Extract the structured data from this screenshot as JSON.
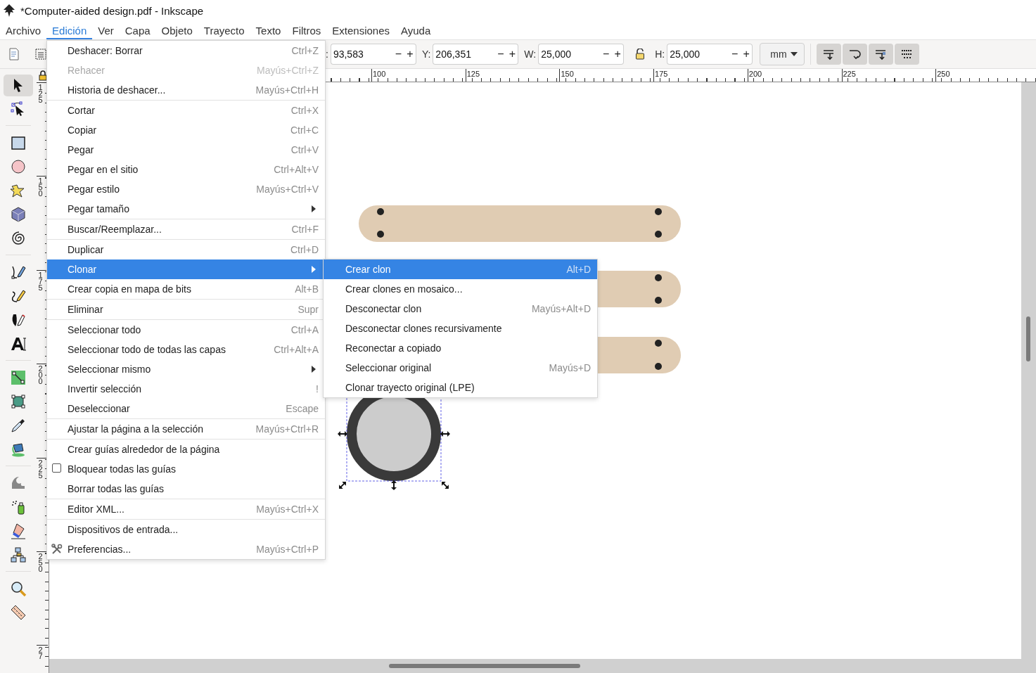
{
  "window": {
    "title": "*Computer-aided design.pdf - Inkscape"
  },
  "menubar": [
    {
      "label": "Archivo",
      "selected": false
    },
    {
      "label": "Edición",
      "selected": true
    },
    {
      "label": "Ver",
      "selected": false
    },
    {
      "label": "Capa",
      "selected": false
    },
    {
      "label": "Objeto",
      "selected": false
    },
    {
      "label": "Trayecto",
      "selected": false
    },
    {
      "label": "Texto",
      "selected": false
    },
    {
      "label": "Filtros",
      "selected": false
    },
    {
      "label": "Extensiones",
      "selected": false
    },
    {
      "label": "Ayuda",
      "selected": false
    }
  ],
  "toolbar": {
    "fields": [
      {
        "label": ":",
        "value": "93,583",
        "minus": "−",
        "plus": "+"
      },
      {
        "label": "Y:",
        "value": "206,351",
        "minus": "−",
        "plus": "+"
      },
      {
        "label": "W:",
        "value": "25,000",
        "minus": "−",
        "plus": "+"
      },
      {
        "label": "H:",
        "value": "25,000",
        "minus": "−",
        "plus": "+"
      }
    ],
    "unit": "mm"
  },
  "tools": [
    {
      "selected": true
    },
    {
      "selected": false
    },
    {
      "selected": false
    },
    {
      "selected": false
    },
    {
      "selected": false
    },
    {
      "selected": false
    },
    {
      "selected": false
    },
    {
      "selected": false
    },
    {
      "selected": false
    },
    {
      "selected": false
    },
    {
      "selected": false
    },
    {
      "selected": false
    },
    {
      "selected": false
    },
    {
      "selected": false
    },
    {
      "selected": false
    },
    {
      "selected": false
    },
    {
      "selected": false
    },
    {
      "selected": false
    },
    {
      "selected": false
    },
    {
      "selected": false
    },
    {
      "selected": false
    }
  ],
  "horizontal_ruler": {
    "labels": [
      "100",
      "125",
      "150",
      "175",
      "200",
      "225",
      "250"
    ]
  },
  "vertical_ruler": {
    "labels": [
      "125",
      "150",
      "175",
      "200",
      "225",
      "250",
      "27"
    ]
  },
  "edit_menu": {
    "items": [
      {
        "kind": "command",
        "label": "Deshacer: Borrar",
        "shortcut": "Ctrl+Z",
        "disabled": false,
        "selected": false
      },
      {
        "kind": "command",
        "label": "Rehacer",
        "shortcut": "Mayús+Ctrl+Z",
        "disabled": true,
        "selected": false
      },
      {
        "kind": "command",
        "label": "Historia de deshacer...",
        "shortcut": "Mayús+Ctrl+H",
        "disabled": false,
        "selected": false
      },
      {
        "kind": "separator"
      },
      {
        "kind": "command",
        "label": "Cortar",
        "shortcut": "Ctrl+X",
        "disabled": false,
        "selected": false
      },
      {
        "kind": "command",
        "label": "Copiar",
        "shortcut": "Ctrl+C",
        "disabled": false,
        "selected": false
      },
      {
        "kind": "command",
        "label": "Pegar",
        "shortcut": "Ctrl+V",
        "disabled": false,
        "selected": false
      },
      {
        "kind": "command",
        "label": "Pegar en el sitio",
        "shortcut": "Ctrl+Alt+V",
        "disabled": false,
        "selected": false
      },
      {
        "kind": "command",
        "label": "Pegar estilo",
        "shortcut": "Mayús+Ctrl+V",
        "disabled": false,
        "selected": false
      },
      {
        "kind": "submenu",
        "label": "Pegar tamaño",
        "disabled": false,
        "selected": false
      },
      {
        "kind": "separator"
      },
      {
        "kind": "command",
        "label": "Buscar/Reemplazar...",
        "shortcut": "Ctrl+F",
        "disabled": false,
        "selected": false
      },
      {
        "kind": "separator"
      },
      {
        "kind": "command",
        "label": "Duplicar",
        "shortcut": "Ctrl+D",
        "disabled": false,
        "selected": false
      },
      {
        "kind": "submenu",
        "label": "Clonar",
        "disabled": false,
        "selected": true
      },
      {
        "kind": "command",
        "label": "Crear copia en mapa de bits",
        "shortcut": "Alt+B",
        "disabled": false,
        "selected": false
      },
      {
        "kind": "separator"
      },
      {
        "kind": "command",
        "label": "Eliminar",
        "shortcut": "Supr",
        "disabled": false,
        "selected": false
      },
      {
        "kind": "separator"
      },
      {
        "kind": "command",
        "label": "Seleccionar todo",
        "shortcut": "Ctrl+A",
        "disabled": false,
        "selected": false
      },
      {
        "kind": "command",
        "label": "Seleccionar todo de todas las capas",
        "shortcut": "Ctrl+Alt+A",
        "disabled": false,
        "selected": false
      },
      {
        "kind": "submenu",
        "label": "Seleccionar mismo",
        "disabled": false,
        "selected": false
      },
      {
        "kind": "command",
        "label": "Invertir selección",
        "shortcut": "!",
        "disabled": false,
        "selected": false
      },
      {
        "kind": "command",
        "label": "Deseleccionar",
        "shortcut": "Escape",
        "disabled": false,
        "selected": false
      },
      {
        "kind": "separator"
      },
      {
        "kind": "command",
        "label": "Ajustar la página a la selección",
        "shortcut": "Mayús+Ctrl+R",
        "disabled": false,
        "selected": false
      },
      {
        "kind": "separator"
      },
      {
        "kind": "command",
        "label": "Crear guías alrededor de la página",
        "disabled": false,
        "selected": false
      },
      {
        "kind": "checkbox",
        "label": "Bloquear todas las guías",
        "checked": false,
        "disabled": false,
        "selected": false
      },
      {
        "kind": "command",
        "label": "Borrar todas las guías",
        "disabled": false,
        "selected": false
      },
      {
        "kind": "separator"
      },
      {
        "kind": "command",
        "label": "Editor XML...",
        "shortcut": "Mayús+Ctrl+X",
        "disabled": false,
        "selected": false
      },
      {
        "kind": "separator"
      },
      {
        "kind": "command",
        "label": "Dispositivos de entrada...",
        "disabled": false,
        "selected": false
      },
      {
        "kind": "iconitem",
        "label": "Preferencias...",
        "shortcut": "Mayús+Ctrl+P",
        "disabled": false,
        "selected": false
      }
    ]
  },
  "clone_menu": {
    "items": [
      {
        "kind": "command",
        "label": "Crear clon",
        "shortcut": "Alt+D",
        "disabled": false,
        "selected": true
      },
      {
        "kind": "command",
        "label": "Crear clones en mosaico...",
        "disabled": false,
        "selected": false
      },
      {
        "kind": "command",
        "label": "Desconectar clon",
        "shortcut": "Mayús+Alt+D",
        "disabled": false,
        "selected": false
      },
      {
        "kind": "command",
        "label": "Desconectar clones recursivamente",
        "disabled": false,
        "selected": false
      },
      {
        "kind": "command",
        "label": "Reconectar a copiado",
        "disabled": false,
        "selected": false
      },
      {
        "kind": "command",
        "label": "Seleccionar original",
        "shortcut": "Mayús+D",
        "disabled": false,
        "selected": false
      },
      {
        "kind": "command",
        "label": "Clonar trayecto original (LPE)",
        "disabled": false,
        "selected": false
      }
    ]
  }
}
